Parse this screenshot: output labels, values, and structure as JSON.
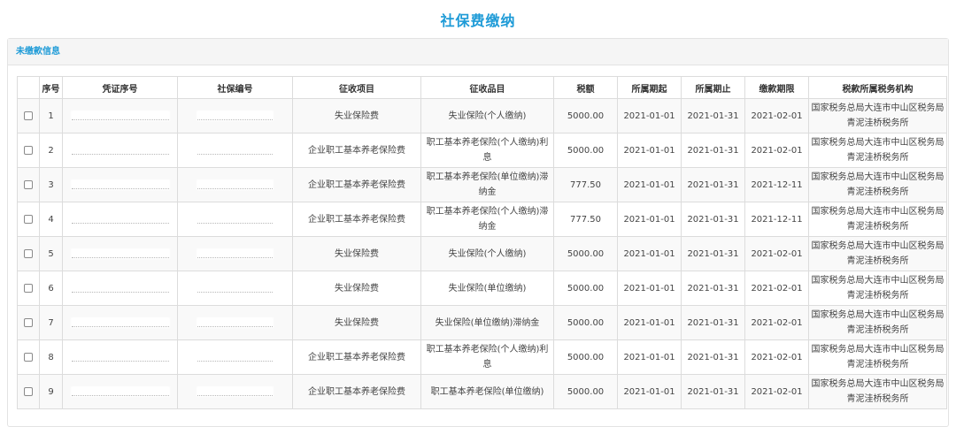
{
  "page": {
    "title": "社保费缴纳"
  },
  "panel": {
    "title": "未缴款信息"
  },
  "table": {
    "headers": [
      "序号",
      "凭证序号",
      "社保编号",
      "征收项目",
      "征收品目",
      "税额",
      "所属期起",
      "所属期止",
      "缴款期限",
      "税款所属税务机构"
    ],
    "rows": [
      {
        "seq": "1",
        "item": "失业保险费",
        "subitem": "失业保险(个人缴纳)",
        "amount": "5000.00",
        "start": "2021-01-01",
        "end": "2021-01-31",
        "deadline": "2021-02-01",
        "org": "国家税务总局大连市中山区税务局青泥洼桥税务所"
      },
      {
        "seq": "2",
        "item": "企业职工基本养老保险费",
        "subitem": "职工基本养老保险(个人缴纳)利息",
        "amount": "5000.00",
        "start": "2021-01-01",
        "end": "2021-01-31",
        "deadline": "2021-02-01",
        "org": "国家税务总局大连市中山区税务局青泥洼桥税务所"
      },
      {
        "seq": "3",
        "item": "企业职工基本养老保险费",
        "subitem": "职工基本养老保险(单位缴纳)滞纳金",
        "amount": "777.50",
        "start": "2021-01-01",
        "end": "2021-01-31",
        "deadline": "2021-12-11",
        "org": "国家税务总局大连市中山区税务局青泥洼桥税务所"
      },
      {
        "seq": "4",
        "item": "企业职工基本养老保险费",
        "subitem": "职工基本养老保险(个人缴纳)滞纳金",
        "amount": "777.50",
        "start": "2021-01-01",
        "end": "2021-01-31",
        "deadline": "2021-12-11",
        "org": "国家税务总局大连市中山区税务局青泥洼桥税务所"
      },
      {
        "seq": "5",
        "item": "失业保险费",
        "subitem": "失业保险(个人缴纳)",
        "amount": "5000.00",
        "start": "2021-01-01",
        "end": "2021-01-31",
        "deadline": "2021-02-01",
        "org": "国家税务总局大连市中山区税务局青泥洼桥税务所"
      },
      {
        "seq": "6",
        "item": "失业保险费",
        "subitem": "失业保险(单位缴纳)",
        "amount": "5000.00",
        "start": "2021-01-01",
        "end": "2021-01-31",
        "deadline": "2021-02-01",
        "org": "国家税务总局大连市中山区税务局青泥洼桥税务所"
      },
      {
        "seq": "7",
        "item": "失业保险费",
        "subitem": "失业保险(单位缴纳)滞纳金",
        "amount": "5000.00",
        "start": "2021-01-01",
        "end": "2021-01-31",
        "deadline": "2021-02-01",
        "org": "国家税务总局大连市中山区税务局青泥洼桥税务所"
      },
      {
        "seq": "8",
        "item": "企业职工基本养老保险费",
        "subitem": "职工基本养老保险(个人缴纳)利息",
        "amount": "5000.00",
        "start": "2021-01-01",
        "end": "2021-01-31",
        "deadline": "2021-02-01",
        "org": "国家税务总局大连市中山区税务局青泥洼桥税务所"
      },
      {
        "seq": "9",
        "item": "企业职工基本养老保险费",
        "subitem": "职工基本养老保险(单位缴纳)",
        "amount": "5000.00",
        "start": "2021-01-01",
        "end": "2021-01-31",
        "deadline": "2021-02-01",
        "org": "国家税务总局大连市中山区税务局青泥洼桥税务所"
      }
    ]
  },
  "colors": {
    "accent": "#1e9bd7",
    "border": "#dcdcdc",
    "row_alt": "#f9f9f9"
  }
}
